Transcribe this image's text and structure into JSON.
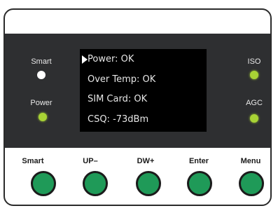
{
  "indicators": {
    "smart": {
      "label": "Smart",
      "led_color": "#ffffff"
    },
    "power": {
      "label": "Power",
      "led_color": "#a8d335"
    },
    "iso": {
      "label": "ISO",
      "led_color": "#a8d335"
    },
    "agc": {
      "label": "AGC",
      "led_color": "#a8d335"
    }
  },
  "display": {
    "selected_index": 0,
    "lines": [
      "Power: OK",
      "Over Temp: OK",
      "SIM Card: OK",
      "CSQ: -73dBm"
    ]
  },
  "buttons": [
    {
      "label": "Smart",
      "color": "#1f9a58"
    },
    {
      "label": "UP–",
      "color": "#1f9a58"
    },
    {
      "label": "DW+",
      "color": "#1f9a58"
    },
    {
      "label": "Enter",
      "color": "#1f9a58"
    },
    {
      "label": "Menu",
      "color": "#1f9a58"
    }
  ],
  "colors": {
    "panel": "#2e2f31",
    "screen": "#000000",
    "screen_text": "#e6e6e6"
  }
}
